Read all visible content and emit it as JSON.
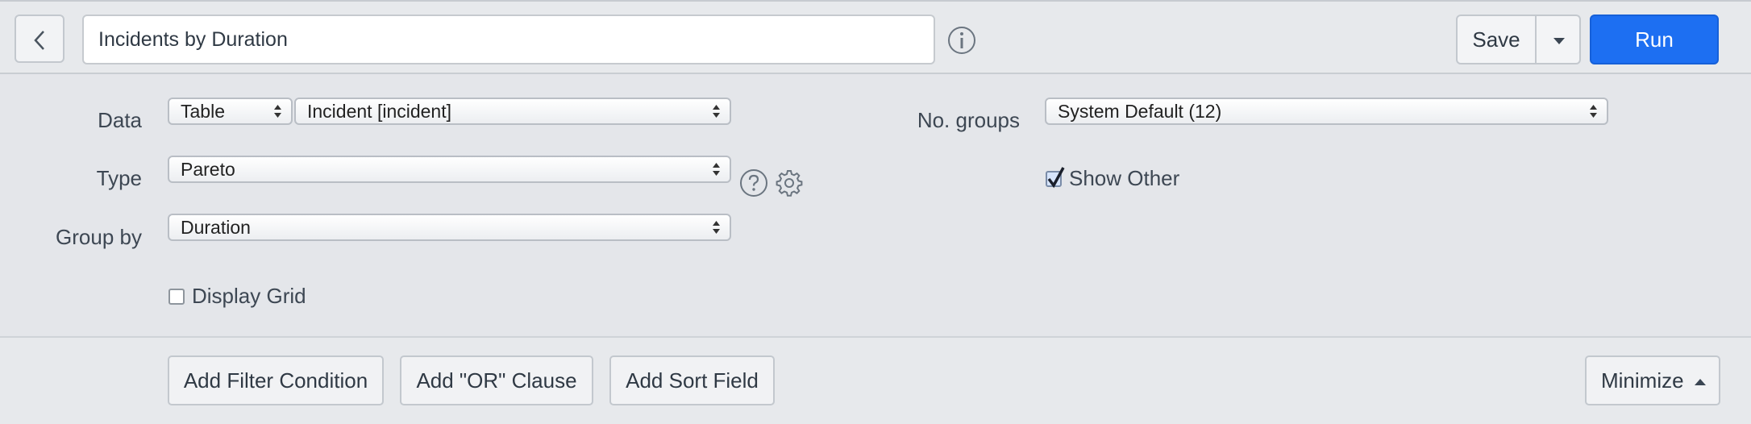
{
  "header": {
    "title_value": "Incidents by Duration",
    "save_label": "Save",
    "run_label": "Run",
    "icons": {
      "back": "chevron-left-icon",
      "info": "info-icon",
      "save_menu": "caret-down-icon"
    }
  },
  "form": {
    "data_label": "Data",
    "data_source_value": "Table",
    "data_table_value": "Incident [incident]",
    "type_label": "Type",
    "type_value": "Pareto",
    "group_by_label": "Group by",
    "group_by_value": "Duration",
    "display_grid_label": "Display Grid",
    "display_grid_checked": false,
    "no_groups_label": "No. groups",
    "no_groups_value": "System Default (12)",
    "show_other_label": "Show Other",
    "show_other_checked": true,
    "icons": {
      "help": "question-circle-icon",
      "settings": "gear-icon"
    }
  },
  "footer": {
    "add_filter_label": "Add Filter Condition",
    "add_or_label": "Add \"OR\" Clause",
    "add_sort_label": "Add Sort Field",
    "minimize_label": "Minimize"
  },
  "colors": {
    "primary": "#1d6ff2",
    "background": "#e4e6ea"
  }
}
